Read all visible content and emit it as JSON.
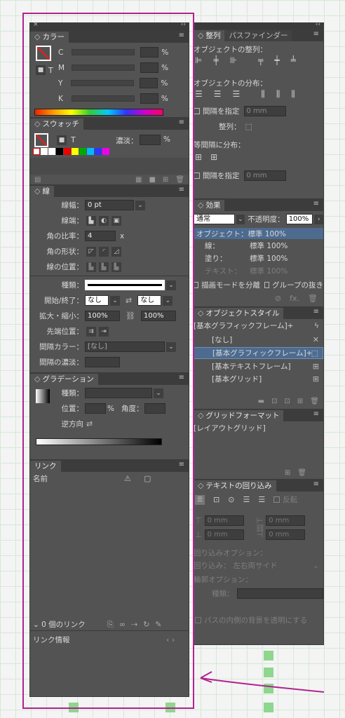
{
  "color": {
    "title": "カラー",
    "c": "C",
    "m": "M",
    "y": "Y",
    "k": "K",
    "pct": "%"
  },
  "swatch": {
    "title": "スウォッチ",
    "tint_label": "濃淡：",
    "pct": "%",
    "t": "T"
  },
  "stroke": {
    "title": "線",
    "weight_label": "線幅：",
    "weight_value": "0 pt",
    "cap_label": "線端：",
    "miter_label": "角の比率：",
    "miter_value": "4",
    "x": "x",
    "join_label": "角の形状：",
    "align_label": "線の位置：",
    "type_label": "種類：",
    "startend_label": "開始/終了：",
    "start_value": "なし",
    "end_value": "なし",
    "scale_label": "拡大・縮小：",
    "scale1": "100%",
    "scale2": "100%",
    "align_tip_label": "先端位置：",
    "gap_color_label": "間隔カラー：",
    "gap_color_value": "[なし]",
    "gap_tint_label": "間隔の濃淡："
  },
  "gradient": {
    "title": "グラデーション",
    "type_label": "種類：",
    "position_label": "位置：",
    "pct": "%",
    "angle_label": "角度：",
    "reverse_label": "逆方向"
  },
  "links": {
    "title": "リンク",
    "name_col": "名前",
    "count": "0 個のリンク",
    "info_title": "リンク情報"
  },
  "align": {
    "tab1": "整列",
    "tab2": "パスファインダー",
    "align_objects": "オブジェクトの整列：",
    "distribute": "オブジェクトの分布：",
    "use_spacing": "間隔を指定",
    "spacing_value": "0 mm",
    "align_to_label": "整列：",
    "distribute_spacing": "等間隔に分布：",
    "use_spacing2": "間隔を指定",
    "spacing_value2": "0 mm"
  },
  "effects": {
    "title": "効果",
    "blend": "通常",
    "opacity_label": "不透明度：",
    "opacity_value": "100%",
    "object": "オブジェクト：標準 100%",
    "stroke": "線：",
    "stroke_val": "標準 100%",
    "fill": "塗り：",
    "fill_val": "標準 100%",
    "text": "テキスト：",
    "text_val": "標準 100%",
    "isolate": "描画モードを分離",
    "knockout": "グループの抜き"
  },
  "object_styles": {
    "title": "オブジェクトスタイル",
    "header": "[基本グラフィックフレーム]+",
    "items": [
      "[なし]",
      "[基本グラフィックフレーム]+",
      "[基本テキストフレーム]",
      "[基本グリッド]"
    ]
  },
  "grid_format": {
    "title": "グリッドフォーマット",
    "item": "[レイアウトグリッド]"
  },
  "text_wrap": {
    "title": "テキストの回り込み",
    "invert": "反転",
    "v1": "0 mm",
    "v2": "0 mm",
    "v3": "0 mm",
    "v4": "0 mm",
    "wrap_options": "回り込みオプション：",
    "wrap_to": "回り込み：",
    "wrap_value": "左右両サイド",
    "contour_options": "輪郭オプション：",
    "type_label": "種類：",
    "transparent": "パスの内側の背景を透明にする"
  }
}
